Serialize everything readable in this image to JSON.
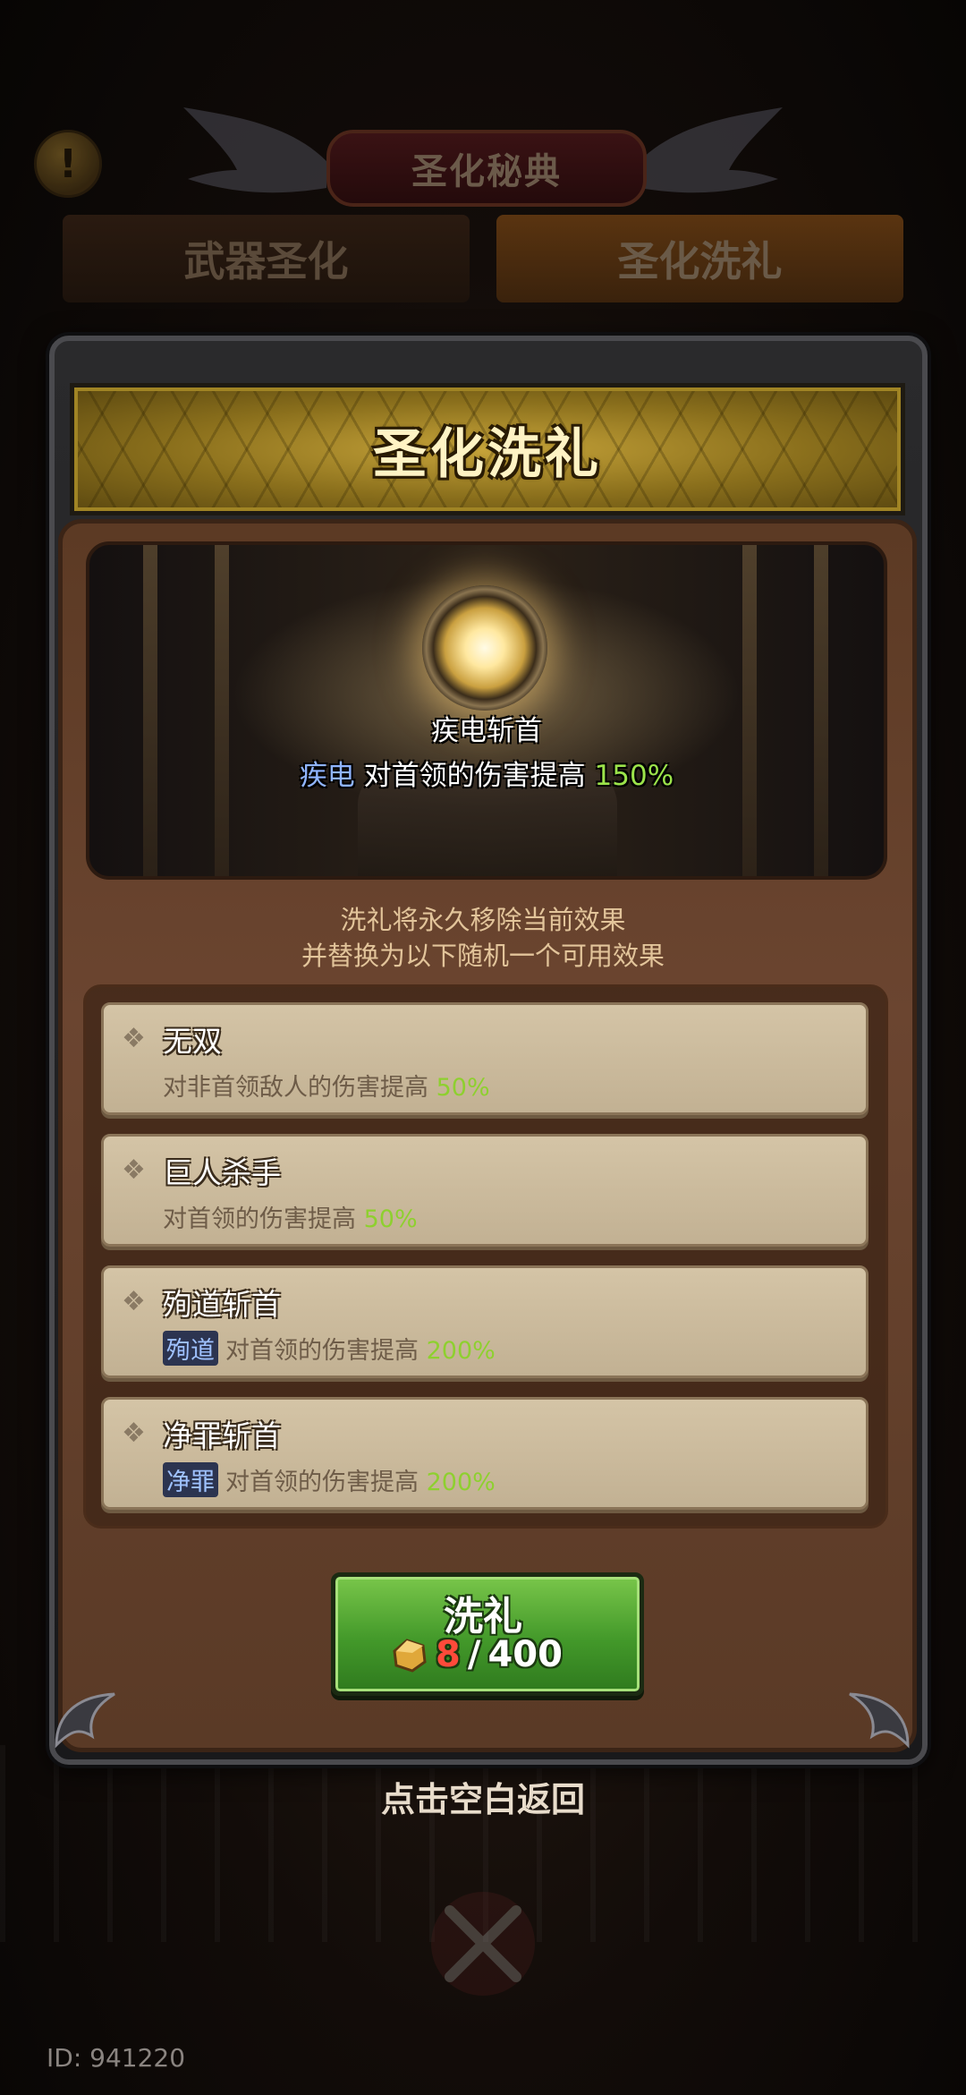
{
  "header": {
    "info_icon": "exclamation-icon",
    "title": "圣化秘典",
    "tabs": [
      {
        "label": "武器圣化",
        "active": false
      },
      {
        "label": "圣化洗礼",
        "active": true
      }
    ]
  },
  "panel": {
    "banner_title": "圣化洗礼",
    "current_skill": {
      "icon": "glowing-orb-icon",
      "name": "疾电斩首",
      "tag": "疾电",
      "effect": "对首领的伤害提高",
      "value": "150%"
    },
    "description_line1": "洗礼将永久移除当前效果",
    "description_line2": "并替换为以下随机一个可用效果",
    "options": [
      {
        "name": "无双",
        "tag": "",
        "effect": "对非首领敌人的伤害提高",
        "value": "50%"
      },
      {
        "name": "巨人杀手",
        "tag": "",
        "effect": "对首领的伤害提高",
        "value": "50%"
      },
      {
        "name": "殉道斩首",
        "tag": "殉道",
        "effect": "对首领的伤害提高",
        "value": "200%"
      },
      {
        "name": "净罪斩首",
        "tag": "净罪",
        "effect": "对首领的伤害提高",
        "value": "200%"
      }
    ],
    "action": {
      "label": "洗礼",
      "cost_icon": "gold-ore-icon",
      "have": "8",
      "separator": "/",
      "need": "400"
    }
  },
  "footer": {
    "back_hint": "点击空白返回",
    "close_icon": "crossed-swords-icon",
    "uid": "ID: 941220"
  },
  "colors": {
    "accent_green": "#8ed02f",
    "tag_blue": "#8fb4ff",
    "cost_red": "#ff4a3a"
  }
}
